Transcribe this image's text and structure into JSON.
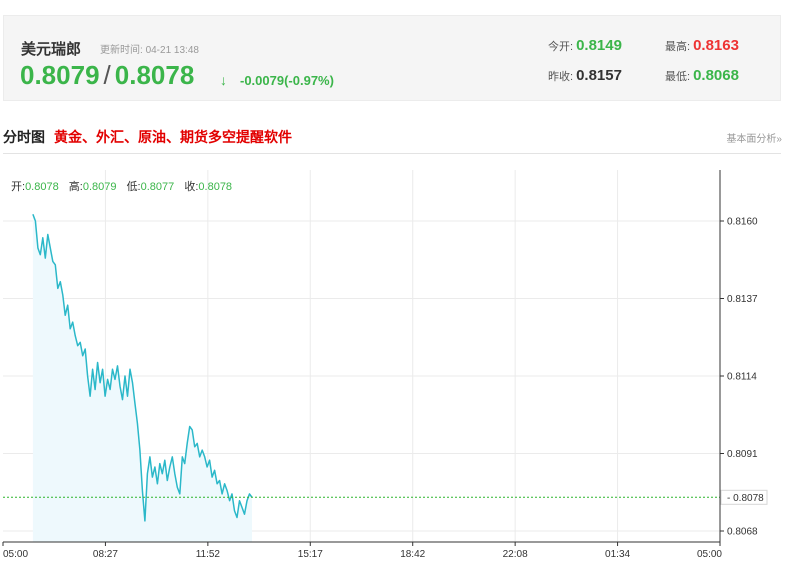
{
  "header": {
    "name": "美元瑞郎",
    "update_label": "更新时间:",
    "update_time": "04-21 13:48",
    "bid": "0.8079",
    "ask": "0.8078",
    "change": "-0.0079(-0.97%)",
    "stats": {
      "open_label": "今开:",
      "open": "0.8149",
      "high_label": "最高:",
      "high": "0.8163",
      "prev_close_label": "昨收:",
      "prev_close": "0.8157",
      "low_label": "最低:",
      "low": "0.8068"
    }
  },
  "section": {
    "title": "分时图",
    "link": "黄金、外汇、原油、期货多空提醒软件",
    "right_link": "基本面分析»"
  },
  "ohlc": {
    "open_label": "开:",
    "open": "0.8078",
    "high_label": "高:",
    "high": "0.8079",
    "low_label": "低:",
    "low": "0.8077",
    "close_label": "收:",
    "close": "0.8078"
  },
  "colors": {
    "up": "#e33333",
    "down": "#3bb54a",
    "line": "#2bb8c9",
    "fill": "#eef9fd",
    "current_marker": "#2db52d"
  },
  "chart_data": {
    "type": "area",
    "x_ticks": [
      "05:00",
      "08:27",
      "11:52",
      "15:17",
      "18:42",
      "22:08",
      "01:34",
      "05:00"
    ],
    "y_ticks": [
      "0.8160",
      "0.8137",
      "0.8114",
      "0.8091",
      "0.8068"
    ],
    "ylim": [
      0.8068,
      0.816
    ],
    "current_price": "0.8078",
    "series": [
      {
        "x_minutes": [
          60,
          65,
          70,
          75,
          80,
          85,
          90,
          95,
          100,
          105,
          110,
          115,
          120,
          125,
          130,
          135,
          140,
          145,
          150,
          155,
          160,
          165,
          170,
          175,
          180,
          185,
          190,
          195,
          200,
          205,
          210,
          215,
          220,
          225,
          230,
          235,
          240,
          245,
          250,
          255,
          260,
          265,
          270,
          275,
          280,
          285,
          290,
          295,
          300,
          305,
          310,
          315,
          320,
          325,
          330,
          335,
          340,
          345,
          350,
          355,
          360,
          365,
          370,
          375,
          380,
          385,
          390,
          395,
          400,
          405,
          410,
          415,
          420,
          425,
          430,
          435,
          440,
          445,
          450,
          455,
          460,
          465,
          470,
          475,
          480,
          485,
          490,
          495,
          500
        ],
        "values": [
          0.8162,
          0.816,
          0.8152,
          0.815,
          0.8155,
          0.8149,
          0.8156,
          0.8152,
          0.8148,
          0.8147,
          0.814,
          0.8142,
          0.8138,
          0.8132,
          0.8135,
          0.8128,
          0.813,
          0.8126,
          0.8123,
          0.8124,
          0.812,
          0.8122,
          0.8114,
          0.8108,
          0.8116,
          0.811,
          0.8118,
          0.8112,
          0.8116,
          0.8108,
          0.8113,
          0.811,
          0.8116,
          0.8113,
          0.8117,
          0.8111,
          0.8107,
          0.8114,
          0.8108,
          0.8116,
          0.8112,
          0.8106,
          0.81,
          0.8092,
          0.808,
          0.8071,
          0.8085,
          0.809,
          0.8084,
          0.8087,
          0.8082,
          0.8088,
          0.8085,
          0.8089,
          0.8083,
          0.8087,
          0.809,
          0.8085,
          0.8081,
          0.8079,
          0.809,
          0.8088,
          0.8094,
          0.8099,
          0.8098,
          0.8093,
          0.8094,
          0.809,
          0.8092,
          0.809,
          0.8087,
          0.8089,
          0.8084,
          0.8086,
          0.8082,
          0.8083,
          0.8079,
          0.8082,
          0.808,
          0.8077,
          0.8079,
          0.8074,
          0.8072,
          0.8077,
          0.8075,
          0.8073,
          0.8077,
          0.8079,
          0.8078
        ]
      }
    ]
  }
}
